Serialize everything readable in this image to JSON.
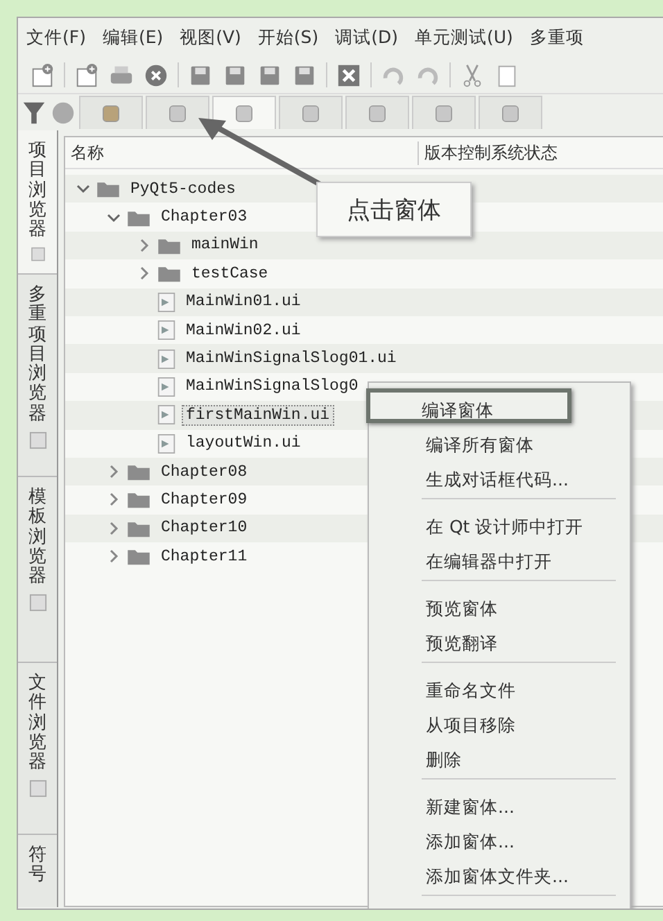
{
  "menubar": [
    {
      "label": "文件(F)"
    },
    {
      "label": "编辑(E)"
    },
    {
      "label": "视图(V)"
    },
    {
      "label": "开始(S)"
    },
    {
      "label": "调试(D)"
    },
    {
      "label": "单元测试(U)"
    },
    {
      "label": "多重项"
    }
  ],
  "browser_tabs": [
    {
      "selected": false
    },
    {
      "selected": false
    },
    {
      "selected": true
    },
    {
      "selected": false
    },
    {
      "selected": false
    },
    {
      "selected": false
    },
    {
      "selected": false
    }
  ],
  "sidebar_tabs": [
    {
      "label": "项目浏览器",
      "selected": true,
      "has_icon": true
    },
    {
      "label": "多重项目浏览器",
      "selected": false,
      "has_icon": true
    },
    {
      "label": "模板浏览器",
      "selected": false,
      "has_icon": true
    },
    {
      "label": "文件浏览器",
      "selected": false,
      "has_icon": true
    },
    {
      "label": "符号",
      "selected": false,
      "has_icon": false
    }
  ],
  "tree": {
    "columns": [
      "名称",
      "版本控制系统状态"
    ],
    "items": [
      {
        "name": "PyQt5-codes",
        "kind": "folder",
        "expanded": true,
        "selected": false,
        "children": [
          {
            "name": "Chapter03",
            "kind": "folder",
            "expanded": true,
            "selected": false,
            "children": [
              {
                "name": "mainWin",
                "kind": "folder",
                "expanded": false,
                "selected": false
              },
              {
                "name": "testCase",
                "kind": "folder",
                "expanded": false,
                "selected": false
              },
              {
                "name": "MainWin01.ui",
                "kind": "file",
                "selected": false
              },
              {
                "name": "MainWin02.ui",
                "kind": "file",
                "selected": false
              },
              {
                "name": "MainWinSignalSlog01.ui",
                "kind": "file",
                "selected": false
              },
              {
                "name": "MainWinSignalSlog0",
                "kind": "file",
                "selected": false
              },
              {
                "name": "firstMainWin.ui",
                "kind": "file",
                "selected": true
              },
              {
                "name": "layoutWin.ui",
                "kind": "file",
                "selected": false
              }
            ]
          },
          {
            "name": "Chapter08",
            "kind": "folder",
            "expanded": false,
            "selected": false
          },
          {
            "name": "Chapter09",
            "kind": "folder",
            "expanded": false,
            "selected": false
          },
          {
            "name": "Chapter10",
            "kind": "folder",
            "expanded": false,
            "selected": false
          },
          {
            "name": "Chapter11",
            "kind": "folder",
            "expanded": false,
            "selected": false
          }
        ]
      }
    ]
  },
  "callout": {
    "text": "点击窗体"
  },
  "context_menu": [
    [
      {
        "label": "编译窗体",
        "highlighted": true
      },
      {
        "label": "编译所有窗体",
        "highlighted": false
      },
      {
        "label": "生成对话框代码...",
        "highlighted": false
      }
    ],
    [
      {
        "label": "在 Qt 设计师中打开",
        "highlighted": false
      },
      {
        "label": "在编辑器中打开",
        "highlighted": false
      }
    ],
    [
      {
        "label": "预览窗体",
        "highlighted": false
      },
      {
        "label": "预览翻译",
        "highlighted": false
      }
    ],
    [
      {
        "label": "重命名文件",
        "highlighted": false
      },
      {
        "label": "从项目移除",
        "highlighted": false
      },
      {
        "label": "删除",
        "highlighted": false
      }
    ],
    [
      {
        "label": "新建窗体...",
        "highlighted": false
      },
      {
        "label": "添加窗体...",
        "highlighted": false
      },
      {
        "label": "添加窗体文件夹...",
        "highlighted": false
      }
    ]
  ]
}
